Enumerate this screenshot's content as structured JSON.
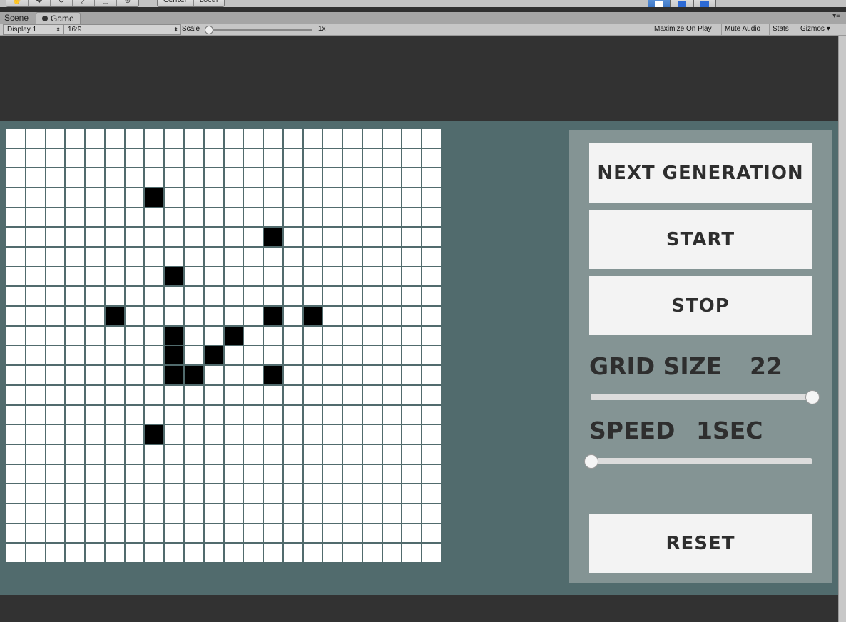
{
  "editor": {
    "pivot": [
      "Center",
      "Local"
    ],
    "tabs": {
      "scene": "Scene",
      "game": "Game"
    },
    "display": "Display 1",
    "aspect": "16:9",
    "scale_label": "Scale",
    "scale_value": "1x",
    "toggles": [
      "Maximize On Play",
      "Mute Audio",
      "Stats",
      "Gizmos"
    ]
  },
  "game": {
    "buttons": {
      "next_generation": "NEXT GENERATION",
      "start": "START",
      "stop": "STOP",
      "reset": "RESET"
    },
    "grid_size": {
      "label": "GRID SIZE",
      "value": "22",
      "slider": 1.0
    },
    "speed": {
      "label": "SPEED",
      "value": "1SEC",
      "slider": 0.0
    },
    "grid": {
      "rows": 22,
      "cols": 22,
      "alive_cells": [
        [
          3,
          7
        ],
        [
          5,
          13
        ],
        [
          7,
          8
        ],
        [
          9,
          5
        ],
        [
          9,
          13
        ],
        [
          9,
          15
        ],
        [
          10,
          8
        ],
        [
          10,
          11
        ],
        [
          11,
          8
        ],
        [
          11,
          10
        ],
        [
          12,
          8
        ],
        [
          12,
          9
        ],
        [
          12,
          13
        ],
        [
          15,
          7
        ]
      ]
    }
  },
  "colors": {
    "game_background": "#516b6d",
    "panel": "#849494",
    "button": "#f3f3f3",
    "cell_dead": "#ffffff",
    "cell_alive": "#000000",
    "text": "#2e2e2e"
  }
}
